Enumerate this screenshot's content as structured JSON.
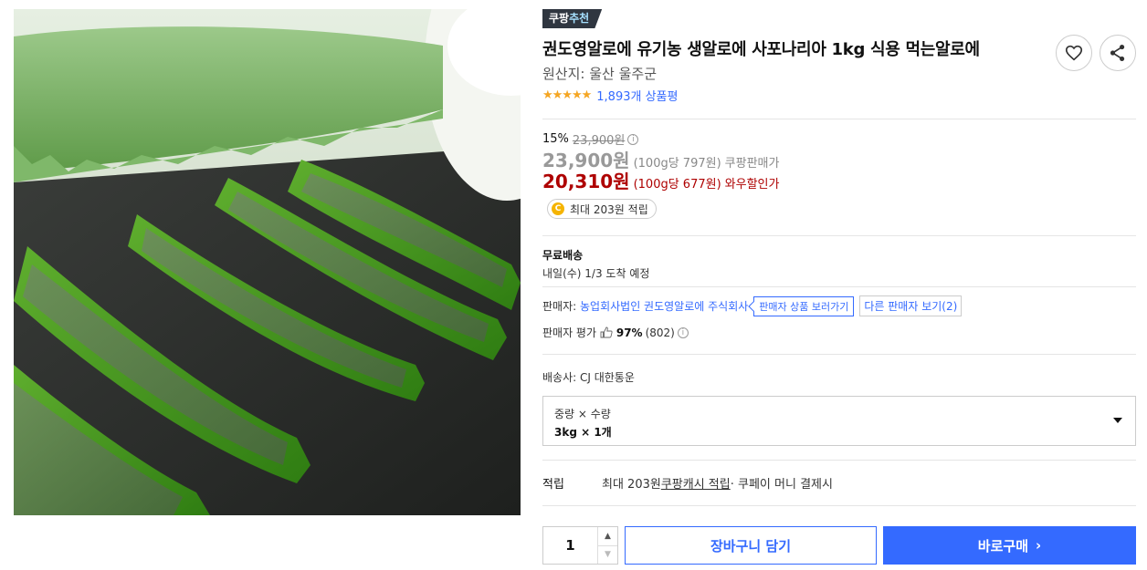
{
  "product": {
    "badge_part1": "쿠팡",
    "badge_part2": "추천",
    "title": "권도영알로에 유기농 생알로에 사포나리아 1kg 식용 먹는알로에",
    "origin": "원산지: 울산 울주군",
    "rating_stars": "★★★★★",
    "rating_value": 4.5,
    "review_count": "1,893개 상품평"
  },
  "price": {
    "discount_rate": "15%",
    "original_price": "23,900원",
    "coupang_price": "23,900원",
    "coupang_unit": "(100g당 797원)",
    "coupang_label": "쿠팡판매가",
    "wow_price": "20,310원",
    "wow_unit": "(100g당 677원)",
    "wow_label": "와우할인가",
    "cash_coin": "C",
    "cash_reward": "최대 203원 적립"
  },
  "shipping": {
    "title": "무료배송",
    "date": "내일(수) 1/3 도착 예정"
  },
  "seller": {
    "label": "판매자:",
    "name": "농업회사법인 권도영알로에 주식회사",
    "view_products": "판매자 상품 보러가기",
    "other_sellers": "다른 판매자 보기(2)",
    "eval_label": "판매자 평가",
    "eval_percent": "97%",
    "eval_count": "(802)"
  },
  "carrier": "배송사: CJ 대한통운",
  "option": {
    "header": "중량 × 수량",
    "selected": "3kg × 1개"
  },
  "reward": {
    "label": "적립",
    "prefix": "최대 203원 ",
    "link": "쿠팡캐시 적립",
    "suffix": " · 쿠페이 머니 결제시"
  },
  "purchase": {
    "quantity": "1",
    "cart_label": "장바구니 담기",
    "buy_label": "바로구매"
  },
  "colors": {
    "accent": "#346aff",
    "wow_red": "#ae0000",
    "star": "#f5a623"
  }
}
